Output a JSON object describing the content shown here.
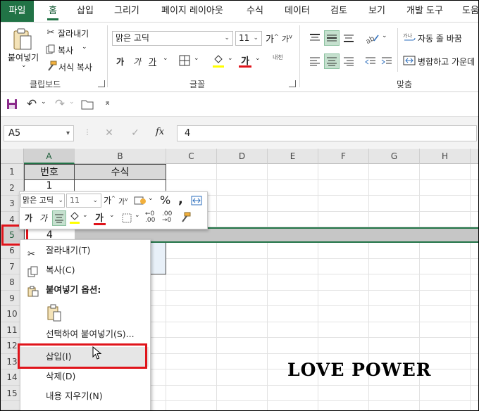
{
  "ribbon_tabs": [
    "파일",
    "홈",
    "삽입",
    "그리기",
    "페이지 레이아웃",
    "수식",
    "데이터",
    "검토",
    "보기",
    "개발 도구",
    "도움"
  ],
  "clipboard": {
    "paste_label": "붙여넣기",
    "cut_label": "잘라내기",
    "copy_label": "복사",
    "format_painter_label": "서식 복사",
    "group_label": "클립보드"
  },
  "font": {
    "font_name": "맑은 고딕",
    "font_size": "11",
    "bold": "가",
    "italic": "가",
    "underline": "가",
    "grow": "가",
    "shrink": "가",
    "font_color_glyph": "가",
    "phonetic": "내천",
    "group_label": "글꼴",
    "accent_red": "#e0141b"
  },
  "alignment": {
    "wrap_text_label": "자동 줄 바꿈",
    "merge_label": "병합하고 가운데",
    "group_label": "맞춤"
  },
  "formula_bar": {
    "name_box": "A5",
    "fx": "fx",
    "value": "4"
  },
  "columns": [
    "A",
    "B",
    "C",
    "D",
    "E",
    "F",
    "G",
    "H"
  ],
  "rows": [
    "1",
    "2",
    "3",
    "4",
    "5",
    "6",
    "7",
    "8",
    "9",
    "10",
    "11",
    "12",
    "13",
    "14",
    "15"
  ],
  "cells": {
    "A1": "번호",
    "B1": "수식",
    "A2": "1",
    "A5": "4"
  },
  "mini_toolbar": {
    "font_name": "맑은 고딕",
    "font_size": "11",
    "percent": "%",
    "comma": ",",
    "bold": "가",
    "italic": "가",
    "font_color_glyph": "가"
  },
  "context_menu": {
    "cut": "잘라내기(T)",
    "copy": "복사(C)",
    "paste_options": "붙여넣기 옵션:",
    "paste_special": "선택하여 붙여넣기(S)...",
    "insert": "삽입(I)",
    "delete": "삭제(D)",
    "clear_contents": "내용 지우기(N)"
  },
  "watermark": "LOVE POWER",
  "colors": {
    "excel_green": "#217346",
    "highlight_red": "#e0141b",
    "selected_row_gray": "#c6c6c6"
  }
}
